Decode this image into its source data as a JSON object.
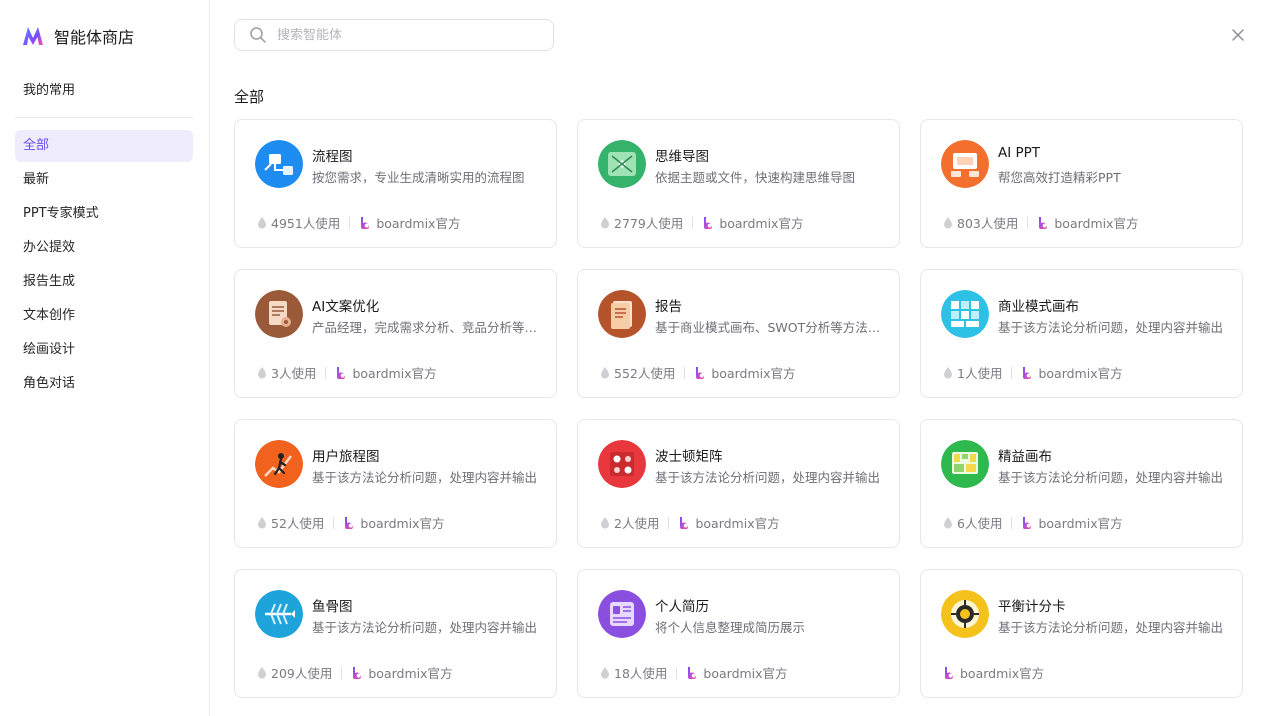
{
  "app": {
    "title": "智能体商店"
  },
  "sidebar": {
    "favorites_label": "我的常用",
    "items": [
      {
        "label": "全部",
        "active": true
      },
      {
        "label": "最新"
      },
      {
        "label": "PPT专家模式"
      },
      {
        "label": "办公提效"
      },
      {
        "label": "报告生成"
      },
      {
        "label": "文本创作"
      },
      {
        "label": "绘画设计"
      },
      {
        "label": "角色对话"
      }
    ]
  },
  "search": {
    "placeholder": "搜索智能体",
    "value": ""
  },
  "main": {
    "section_title": "全部",
    "cards": [
      {
        "title": "流程图",
        "desc": "按您需求，专业生成清晰实用的流程图",
        "uses": "4951人使用",
        "author": "boardmix官方",
        "icon": "flowchart-icon",
        "color": "#1e8cf0"
      },
      {
        "title": "思维导图",
        "desc": "依据主题或文件，快速构建思维导图",
        "uses": "2779人使用",
        "author": "boardmix官方",
        "icon": "mindmap-icon",
        "color": "#35b36b"
      },
      {
        "title": "AI PPT",
        "desc": "帮您高效打造精彩PPT",
        "uses": "803人使用",
        "author": "boardmix官方",
        "icon": "ppt-icon",
        "color": "#f36f2e"
      },
      {
        "title": "AI文案优化",
        "desc": "产品经理，完成需求分析、竞品分析等工作",
        "uses": "3人使用",
        "author": "boardmix官方",
        "icon": "copywriting-icon",
        "color": "#9a5a3a"
      },
      {
        "title": "报告",
        "desc": "基于商业模式画布、SWOT分析等方法生成报告",
        "uses": "552人使用",
        "author": "boardmix官方",
        "icon": "report-icon",
        "color": "#b5532b"
      },
      {
        "title": "商业模式画布",
        "desc": "基于该方法论分析问题，处理内容并输出",
        "uses": "1人使用",
        "author": "boardmix官方",
        "icon": "business-canvas-icon",
        "color": "#2ec1e6"
      },
      {
        "title": "用户旅程图",
        "desc": "基于该方法论分析问题，处理内容并输出",
        "uses": "52人使用",
        "author": "boardmix官方",
        "icon": "user-journey-icon",
        "color": "#f0621e"
      },
      {
        "title": "波士顿矩阵",
        "desc": "基于该方法论分析问题，处理内容并输出",
        "uses": "2人使用",
        "author": "boardmix官方",
        "icon": "bcg-matrix-icon",
        "color": "#e8383d"
      },
      {
        "title": "精益画布",
        "desc": "基于该方法论分析问题，处理内容并输出",
        "uses": "6人使用",
        "author": "boardmix官方",
        "icon": "lean-canvas-icon",
        "color": "#2fb84d"
      },
      {
        "title": "鱼骨图",
        "desc": "基于该方法论分析问题，处理内容并输出",
        "uses": "209人使用",
        "author": "boardmix官方",
        "icon": "fishbone-icon",
        "color": "#1fa3db"
      },
      {
        "title": "个人简历",
        "desc": "将个人信息整理成简历展示",
        "uses": "18人使用",
        "author": "boardmix官方",
        "icon": "resume-icon",
        "color": "#8b4fe0"
      },
      {
        "title": "平衡计分卡",
        "desc": "基于该方法论分析问题，处理内容并输出",
        "uses": "",
        "author": "boardmix官方",
        "icon": "balanced-scorecard-icon",
        "color": "#f5c21b"
      }
    ]
  }
}
